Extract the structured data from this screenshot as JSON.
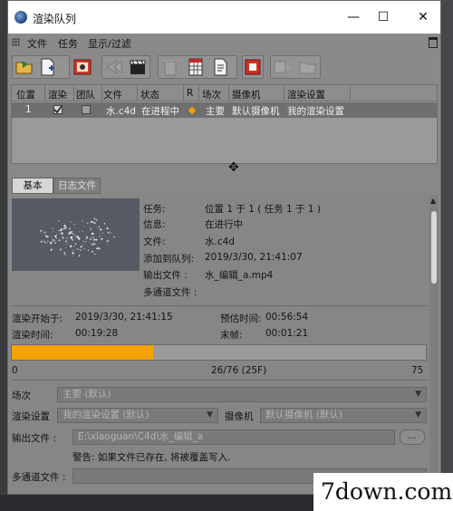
{
  "window": {
    "title": "渲染队列",
    "minimize": "—",
    "maximize": "☐",
    "close": "✕"
  },
  "menu": [
    "文件",
    "任务",
    "显示/过滤"
  ],
  "toolbar_icons": [
    "open-folder-icon",
    "add-file-icon",
    "render-icon",
    "render-disabled-icon",
    "clapper-icon",
    "delete-icon",
    "grid-file-icon",
    "edit-file-icon",
    "stop-icon",
    "options-icon",
    "folder-disabled-icon"
  ],
  "queue": {
    "columns": [
      "位置",
      "渲染",
      "团队",
      "文件",
      "状态",
      "R",
      "场次",
      "摄像机",
      "渲染设置"
    ],
    "row": {
      "position": "1",
      "render_checked": true,
      "team_checked": false,
      "file": "水.c4d",
      "status": "在进程中",
      "take": "主要",
      "camera": "默认摄像机",
      "render_setting": "我的渲染设置"
    }
  },
  "tabs": [
    "基本",
    "日志文件"
  ],
  "details": {
    "task_label": "任务:",
    "task_value": "位置 1 于 1 ( 任务 1 于 1 )",
    "info_label": "信息:",
    "info_value": "在进行中",
    "file_label": "文件:",
    "file_value": "水.c4d",
    "added_label": "添加到队列:",
    "added_value": "2019/3/30, 21:41:07",
    "output_label": "输出文件 :",
    "output_value": "水_编辑_a.mp4",
    "multipass_label": "多通道文件 :",
    "multipass_value": ""
  },
  "render_stats": {
    "start_label": "渲染开始于:",
    "start_value": "2019/3/30, 21:41:15",
    "estimate_label": "预估时间:",
    "estimate_value": "00:56:54",
    "elapsed_label": "渲染时间:",
    "elapsed_value": "00:19:28",
    "last_frame_label": "末帧:",
    "last_frame_value": "00:01:21"
  },
  "progress": {
    "fraction": 0.342,
    "start": "0",
    "current": "26/76 (25F)",
    "end": "75"
  },
  "settings": {
    "take_label": "场次",
    "take_value": "主要 (默认)",
    "render_setting_label": "渲染设置",
    "render_setting_value": "我的渲染设置 (默认)",
    "camera_label": "摄像机",
    "camera_value": "默认摄像机 (默认)",
    "output_label": "输出文件 :",
    "output_value": "E:\\xiaoguan\\C4d\\水_编辑_a",
    "browse_label": "...",
    "warning": "警告: 如果文件已存在, 将被覆盖写入.",
    "multipass_label": "多通道文件 :",
    "multipass_value": ""
  },
  "watermark": "7down.com",
  "colors": {
    "progress": "#f4a300",
    "window_bg": "#888888",
    "row_selected": "#6f6f6f"
  }
}
